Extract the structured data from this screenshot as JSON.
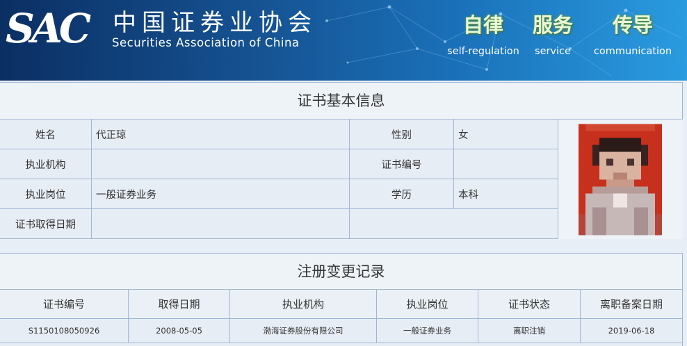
{
  "header": {
    "logo_text": "SAC",
    "org_name_cn": "中国证券业协会",
    "org_name_en": "Securities Association of China",
    "motto": [
      {
        "cn": "自律",
        "en": "self-regulation"
      },
      {
        "cn": "服务",
        "en": "service"
      },
      {
        "cn": "传导",
        "en": "communication"
      }
    ],
    "colors": {
      "banner_dark": "#0b2f63",
      "banner_light": "#2a9be0",
      "motto_green": "#6fa43a"
    }
  },
  "cert_info": {
    "title": "证书基本信息",
    "fields": {
      "name": {
        "label": "姓名",
        "value": "代正琼"
      },
      "gender": {
        "label": "性别",
        "value": "女"
      },
      "org": {
        "label": "执业机构",
        "value": ""
      },
      "cert_no": {
        "label": "证书编号",
        "value": ""
      },
      "position": {
        "label": "执业岗位",
        "value": "一般证券业务"
      },
      "education": {
        "label": "学历",
        "value": "本科"
      },
      "cert_date": {
        "label": "证书取得日期",
        "value": ""
      }
    },
    "photo": {
      "icon": "pixelated-portrait-photo",
      "background": "#c8301e"
    }
  },
  "records": {
    "title": "注册变更记录",
    "columns": [
      "证书编号",
      "取得日期",
      "执业机构",
      "执业岗位",
      "证书状态",
      "离职备案日期"
    ],
    "rows": [
      [
        "S1150108050926",
        "2008-05-05",
        "渤海证券股份有限公司",
        "一般证券业务",
        "离职注销",
        "2019-06-18"
      ]
    ]
  }
}
